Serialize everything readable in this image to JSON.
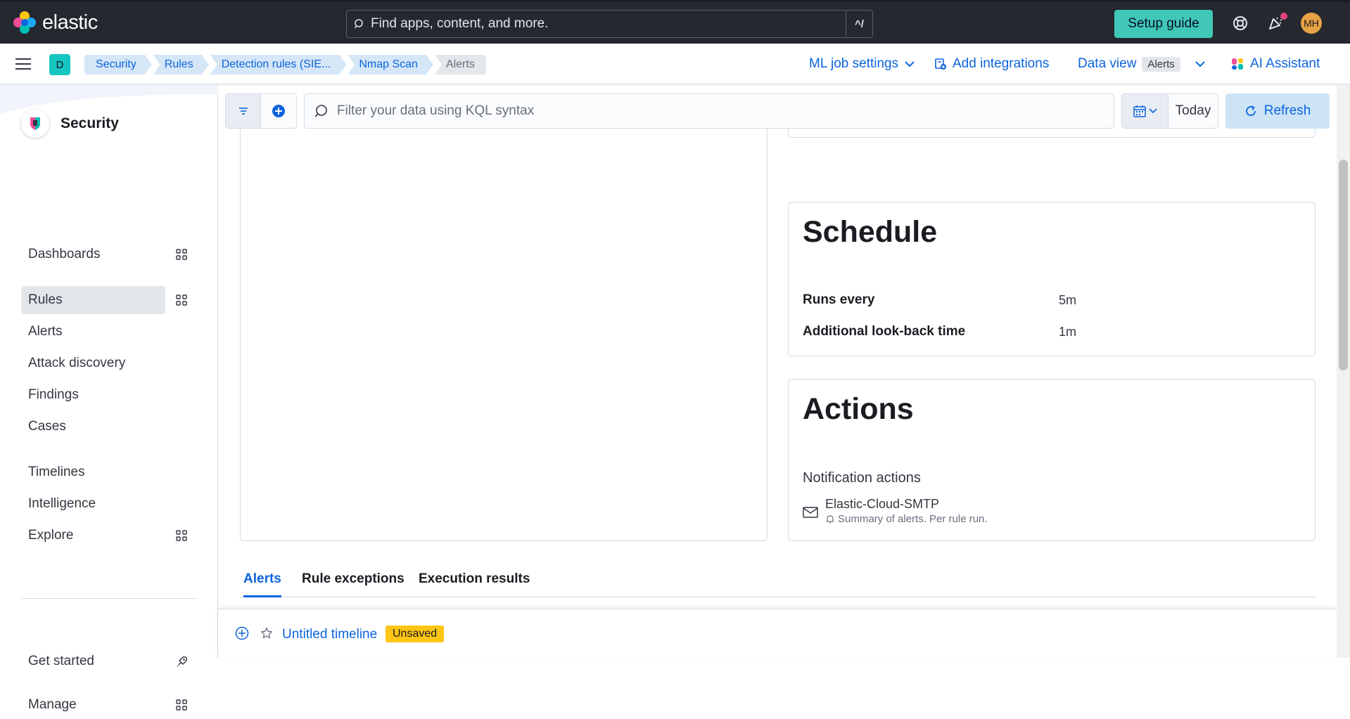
{
  "header": {
    "brand": "elastic",
    "search_placeholder": "Find apps, content, and more.",
    "search_shortcut": "^/",
    "setup_guide": "Setup guide",
    "avatar_initials": "MH"
  },
  "breadcrumbs": {
    "space": "D",
    "items": [
      "Security",
      "Rules",
      "Detection rules (SIE...",
      "Nmap Scan",
      "Alerts"
    ]
  },
  "header_actions": {
    "ml_job_settings": "ML job settings",
    "add_integrations": "Add integrations",
    "data_view_label": "Data view",
    "data_view_value": "Alerts",
    "ai_assistant": "AI Assistant"
  },
  "sidenav": {
    "title": "Security",
    "items": [
      {
        "label": "Dashboards"
      },
      {
        "label": "Rules"
      },
      {
        "label": "Alerts"
      },
      {
        "label": "Attack discovery"
      },
      {
        "label": "Findings"
      },
      {
        "label": "Cases"
      },
      {
        "label": "Timelines"
      },
      {
        "label": "Intelligence"
      },
      {
        "label": "Explore"
      }
    ],
    "get_started": "Get started",
    "manage": "Manage"
  },
  "filterbar": {
    "kql_placeholder": "Filter your data using KQL syntax",
    "date": "Today",
    "refresh": "Refresh"
  },
  "schedule": {
    "title": "Schedule",
    "rows": [
      {
        "key": "Runs every",
        "value": "5m"
      },
      {
        "key": "Additional look-back time",
        "value": "1m"
      }
    ]
  },
  "actions": {
    "title": "Actions",
    "notification_title": "Notification actions",
    "connector_name": "Elastic-Cloud-SMTP",
    "connector_summary": "Summary of alerts. Per rule run."
  },
  "tabs": [
    "Alerts",
    "Rule exceptions",
    "Execution results"
  ],
  "timeline": {
    "title": "Untitled timeline",
    "status": "Unsaved"
  },
  "colors": {
    "accent": "#0b64dd",
    "header_bg": "#25282f",
    "setup_button": "#40c7b8",
    "unsaved_badge": "#fec514",
    "refresh_bg": "#cce4f5"
  }
}
